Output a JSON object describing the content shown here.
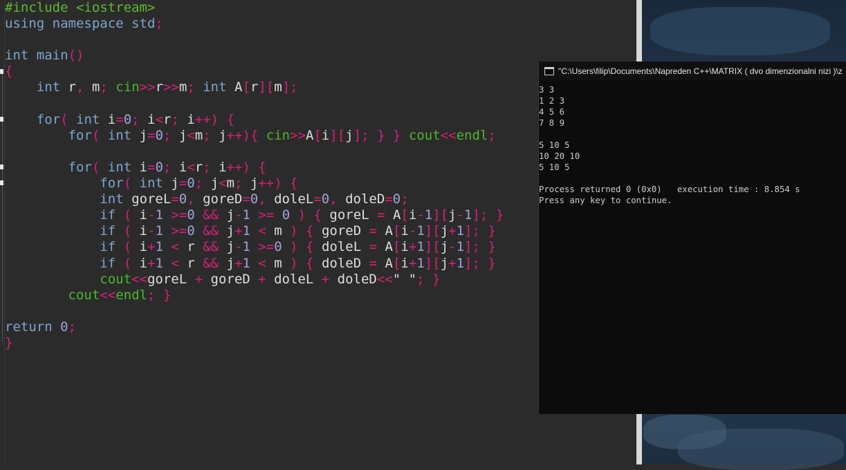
{
  "editor": {
    "language": "C++",
    "lines": [
      "#include <iostream>",
      "using namespace std;",
      "",
      "int main()",
      "{",
      "    int r, m; cin>>r>>m; int A[r][m];",
      "",
      "    for( int i=0; i<r; i++) {",
      "        for( int j=0; j<m; j++){ cin>>A[i][j]; } } cout<<endl;",
      "",
      "        for( int i=0; i<r; i++) {",
      "            for( int j=0; j<m; j++) {",
      "            int goreL=0, goreD=0, doleL=0, doleD=0;",
      "            if ( i-1 >=0 && j-1 >= 0 ) { goreL = A[i-1][j-1]; }",
      "            if ( i-1 >=0 && j+1 < m ) { goreD = A[i-1][j+1]; }",
      "            if ( i+1 < r && j-1 >=0 ) { doleL = A[i+1][j-1]; }",
      "            if ( i+1 < r && j+1 < m ) { doleD = A[i+1][j+1]; }",
      "            cout<<goreL + goreD + doleL + doleD<<\" \"; }",
      "        cout<<endl; }",
      "",
      "return 0;",
      "}"
    ]
  },
  "console": {
    "title": "\"C:\\Users\\filip\\Documents\\Napreden C++\\MATRIX ( dvo dimenzionalni nizi )\\z",
    "output": "3 3\n1 2 3\n4 5 6\n7 8 9\n\n5 10 5\n10 20 10\n5 10 5\n\nProcess returned 0 (0x0)   execution time : 8.854 s\nPress any key to continue."
  }
}
